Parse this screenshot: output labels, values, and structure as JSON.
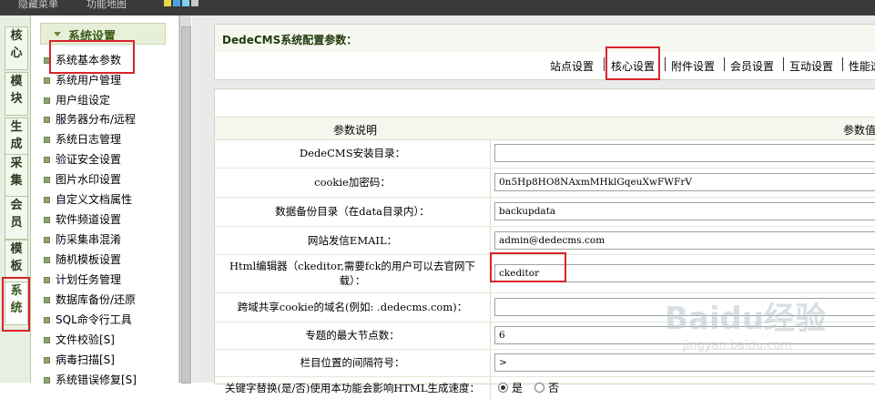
{
  "topbar": {
    "links": [
      "隐藏菜单",
      "功能地图"
    ],
    "swatches": [
      "#e6d84a",
      "#4aa3e0",
      "#7fd1f0",
      "#c8c8c8"
    ]
  },
  "module_tabs": [
    {
      "label": "核心",
      "active": false
    },
    {
      "label": "模块",
      "active": false
    },
    {
      "label": "生成",
      "active": false
    },
    {
      "label": "采集",
      "active": false
    },
    {
      "label": "会员",
      "active": false
    },
    {
      "label": "模板",
      "active": false
    },
    {
      "label": "系统",
      "active": true
    }
  ],
  "sidebar": {
    "header": "系统设置",
    "items": [
      "系统基本参数",
      "系统用户管理",
      "用户组设定",
      "服务器分布/远程",
      "系统日志管理",
      "验证安全设置",
      "图片水印设置",
      "自定义文档属性",
      "软件频道设置",
      "防采集串混淆",
      "随机模板设置",
      "计划任务管理",
      "数据库备份/还原",
      "SQL命令行工具",
      "文件校验[S]",
      "病毒扫描[S]",
      "系统错误修复[S]"
    ]
  },
  "main": {
    "panel_title": "DedeCMS系统配置参数：",
    "tabs": [
      "站点设置",
      "核心设置",
      "附件设置",
      "会员设置",
      "互动设置",
      "性能选"
    ],
    "table_header": {
      "desc": "参数说明",
      "value": "参数值"
    },
    "rows": [
      {
        "label": "DedeCMS安装目录：",
        "value": ""
      },
      {
        "label": "cookie加密码：",
        "value": "0n5Hp8HO8NAxmMHklGqeuXwFWFrV"
      },
      {
        "label": "数据备份目录（在data目录内）：",
        "value": "backupdata"
      },
      {
        "label": "网站发信EMAIL：",
        "value": "admin@dedecms.com"
      },
      {
        "label": "Html编辑器（ckeditor,需要fck的用户可以去官网下载）：",
        "value": "ckeditor"
      },
      {
        "label": "跨域共享cookie的域名(例如: .dedecms.com)：",
        "value": ""
      },
      {
        "label": "专题的最大节点数：",
        "value": "6"
      },
      {
        "label": "栏目位置的间隔符号：",
        "value": ">"
      },
      {
        "label": "关键字替换(是/否)使用本功能会影响HTML生成速度：",
        "radio": [
          "是",
          "否"
        ],
        "radio_selected": 0
      }
    ]
  },
  "watermark": {
    "line1": "Baidu经验",
    "line2": "jingyan.baidu.com"
  },
  "colors": {
    "highlight": "#d9232b",
    "active_green": "#395a1c"
  }
}
